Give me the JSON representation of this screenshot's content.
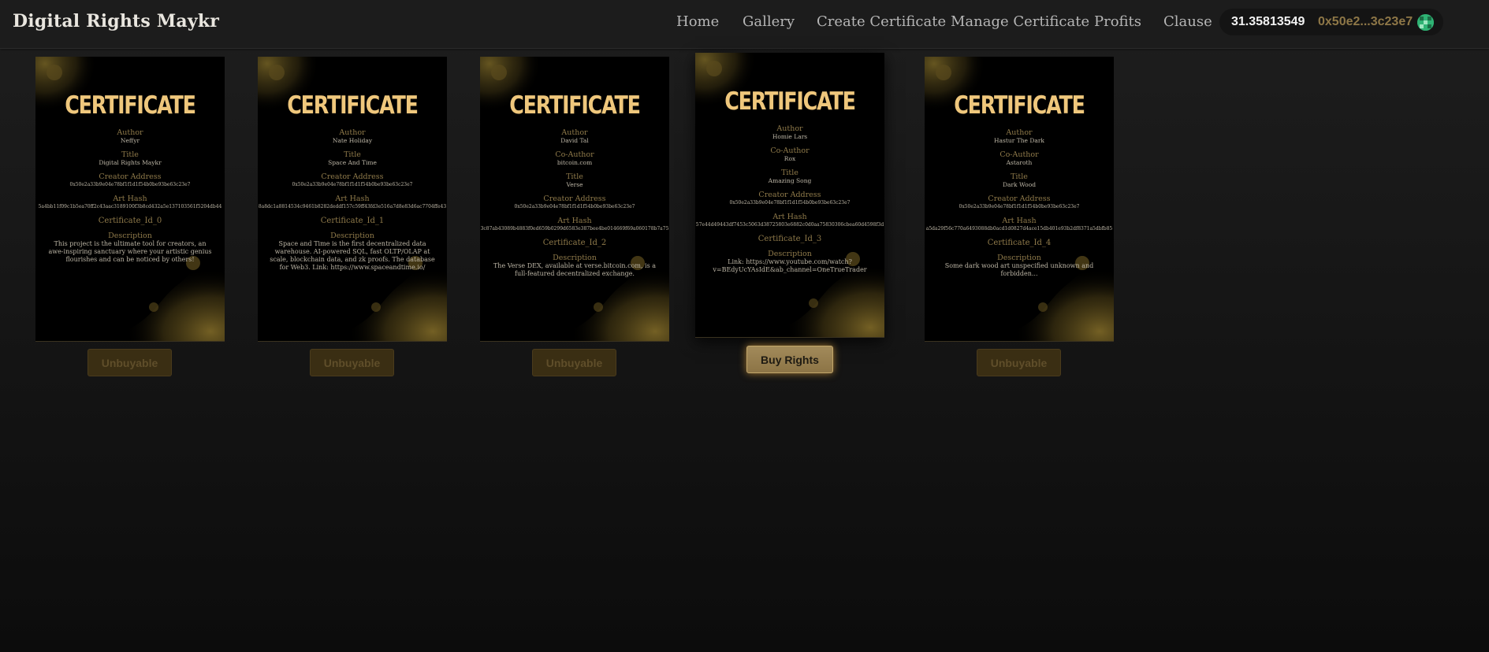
{
  "app": {
    "title": "Digital Rights Maykr"
  },
  "nav": {
    "items": [
      {
        "label": "Home"
      },
      {
        "label": "Gallery"
      },
      {
        "label": "Create Certificate"
      },
      {
        "label": "Manage Certificate"
      },
      {
        "label": "Profits"
      },
      {
        "label": "Clause"
      }
    ]
  },
  "wallet": {
    "balance": "31.35813549",
    "address": "0x50e2...3c23e7",
    "avatar_icon": "avatar-icon"
  },
  "colors": {
    "accent": "#efc77c",
    "label": "#8f7a4a",
    "button_active": "#a28a5a",
    "button_disabled": "#3a2e13"
  },
  "cards": [
    {
      "heading": "CERTIFICATE",
      "author_label": "Author",
      "author": "Neffyr",
      "coauthor_label": "",
      "coauthor": "",
      "title_label": "Title",
      "title": "Digital Rights Maykr",
      "creator_label": "Creator Address",
      "creator": "0x50e2a33b9e04e78bf1f1d1f54b0be93be63c23e7",
      "hash_label": "Art Hash",
      "hash": "5a4bb11f09c1b5ea70ff2c43aac3189100f3b8cd432a5e137103561f5204db44",
      "cert_id": "Certificate_Id_0",
      "desc_label": "Description",
      "description": "This project is the ultimate tool for creators, an awe-inspiring sanctuary where your artistic genius flourishes and can be noticed by others!",
      "button": "Unbuyable"
    },
    {
      "heading": "CERTIFICATE",
      "author_label": "Author",
      "author": "Nate Holiday",
      "coauthor_label": "",
      "coauthor": "",
      "title_label": "Title",
      "title": "Space And Time",
      "creator_label": "Creator Address",
      "creator": "0x50e2a33b9e04e78bf1f1d1f54b0be93be63c23e7",
      "hash_label": "Art Hash",
      "hash": "8a8dc1a8814534c9461b8282deddf157c59ff43fd3e516a7d8e83d6ac7704ffe43",
      "cert_id": "Certificate_Id_1",
      "desc_label": "Description",
      "description": "Space and Time is the first decentralized data warehouse. AI-powered SQL, fast OLTP/OLAP at scale, blockchain data, and zk proofs. The database for Web3. Link: https://www.spaceandtime.io/",
      "button": "Unbuyable"
    },
    {
      "heading": "CERTIFICATE",
      "author_label": "Author",
      "author": "David Tal",
      "coauthor_label": "Co-Author",
      "coauthor": "bitcoin.com",
      "title_label": "Title",
      "title": "Verse",
      "creator_label": "Creator Address",
      "creator": "0x50e2a33b9e04e78bf1f1d1f54b0be93be63c23e7",
      "hash_label": "Art Hash",
      "hash": "3c87ab43089b4883f0ed659b0299d6583e387bee4be014669f69a060178b7a75",
      "cert_id": "Certificate_Id_2",
      "desc_label": "Description",
      "description": "The Verse DEX, available at verse.bitcoin.com, is a full-featured decentralized exchange.",
      "button": "Unbuyable"
    },
    {
      "heading": "CERTIFICATE",
      "author_label": "Author",
      "author": "Homie Lars",
      "coauthor_label": "Co-Author",
      "coauthor": "Rox",
      "title_label": "Title",
      "title": "Amazing Song",
      "creator_label": "Creator Address",
      "creator": "0x50e2a33b9e04e78bf1f1d1f54b0be93be63c23e7",
      "hash_label": "Art Hash",
      "hash": "57e44d49443df7453c5063d38725803e6882c0d0aa75830306cbea60d4598f3d",
      "cert_id": "Certificate_Id_3",
      "desc_label": "Description",
      "description": "Link: https://www.youtube.com/watch?v=BEdyUcYAsIdE&ab_channel=OneTrueTrader",
      "button": "Buy Rights"
    },
    {
      "heading": "CERTIFICATE",
      "author_label": "Author",
      "author": "Hastur The Dark",
      "coauthor_label": "Co-Author",
      "coauthor": "Astaroth",
      "title_label": "Title",
      "title": "Dark Wood",
      "creator_label": "Creator Address",
      "creator": "0x50e2a33b9e04e78bf1f1d1f54b0be93be63c23e7",
      "hash_label": "Art Hash",
      "hash": "a5da29f56c770a6493088db0acd1d0827d4ace15db401e93b2df8371a5dbfb85",
      "cert_id": "Certificate_Id_4",
      "desc_label": "Description",
      "description": "Some dark wood art unspecified unknown and forbidden...",
      "button": "Unbuyable"
    }
  ]
}
